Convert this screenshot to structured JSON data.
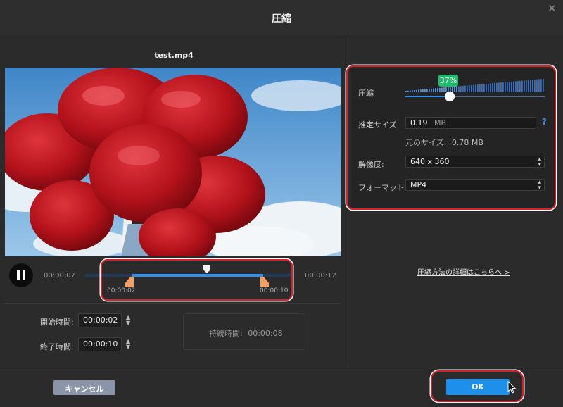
{
  "dialog": {
    "title": "圧縮",
    "close_icon": "close-icon"
  },
  "video": {
    "filename": "test.mp4",
    "preview": "video-preview-balloons"
  },
  "playback": {
    "pause_icon": "pause-icon",
    "current_time": "00:00:07",
    "total_time": "00:00:12",
    "trim_start_label": "00:00:02",
    "trim_end_label": "00:00:10"
  },
  "trim": {
    "start_label": "開始時間:",
    "start_value": "00:00:02",
    "end_label": "終了時間:",
    "end_value": "00:00:10",
    "duration_label": "持続時間:",
    "duration_value": "00:00:08"
  },
  "settings": {
    "compression_label": "圧縮",
    "compression_percent": "37%",
    "compression_level": 0.37,
    "estimated_size_label": "推定サイズ",
    "estimated_size_value": "0.19",
    "estimated_size_unit": "MB",
    "original_size_label": "元のサイズ:",
    "original_size_value": "0.78 MB",
    "resolution_label": "解像度:",
    "resolution_value": "640 x 360",
    "format_label": "フォーマット:",
    "format_value": "MP4",
    "help_icon": "?",
    "details_link": "圧縮方法の詳細はこちらへ >"
  },
  "footer": {
    "cancel_label": "キャンセル",
    "ok_label": "OK"
  },
  "colors": {
    "accent": "#1e90ea",
    "highlight": "#d8202a",
    "badge": "#1dbb6a",
    "trim_handle": "#f4a064"
  }
}
